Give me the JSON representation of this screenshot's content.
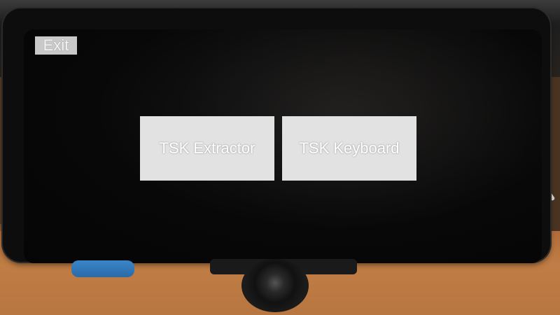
{
  "screen": {
    "exit_label": "Exit",
    "apps": [
      {
        "label": "TSK Extractor"
      },
      {
        "label": "TSK Keyboard"
      }
    ]
  },
  "colors": {
    "screen_background": "#050505",
    "button_background": "#e2e2e2",
    "button_text": "#ffffff"
  }
}
